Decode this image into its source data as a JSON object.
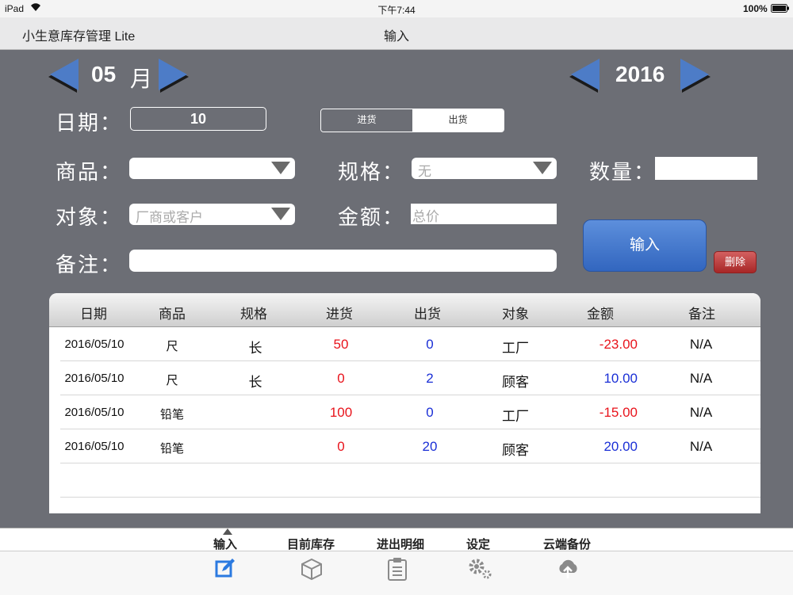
{
  "status_bar": {
    "device": "iPad",
    "time": "下午7:44",
    "battery": "100%"
  },
  "nav": {
    "app_title": "小生意库存管理 Lite",
    "screen_title": "输入"
  },
  "month_selector": {
    "value": "05",
    "unit": "月"
  },
  "year_selector": {
    "value": "2016"
  },
  "form": {
    "date_label": "日期：",
    "date_value": "10",
    "segment": {
      "options": [
        "进货",
        "出货"
      ],
      "selected": "进货"
    },
    "product_label": "商品：",
    "product_value": "",
    "spec_label": "规格：",
    "spec_placeholder": "无",
    "quantity_label": "数量：",
    "quantity_value": "",
    "target_label": "对象：",
    "target_placeholder": "厂商或客户",
    "amount_label": "金额：",
    "amount_placeholder": "总价",
    "note_label": "备注：",
    "note_value": "",
    "input_button": "输入",
    "delete_button": "删除"
  },
  "table": {
    "headers": [
      "日期",
      "商品",
      "规格",
      "进货",
      "出货",
      "对象",
      "金额",
      "备注"
    ],
    "rows": [
      {
        "date": "2016/05/10",
        "product": "尺",
        "spec": "长",
        "in": "50",
        "out": "0",
        "target": "工厂",
        "amount": "-23.00",
        "note": "N/A"
      },
      {
        "date": "2016/05/10",
        "product": "尺",
        "spec": "长",
        "in": "0",
        "out": "2",
        "target": "顾客",
        "amount": "10.00",
        "note": "N/A"
      },
      {
        "date": "2016/05/10",
        "product": "铅笔",
        "spec": "",
        "in": "100",
        "out": "0",
        "target": "工厂",
        "amount": "-15.00",
        "note": "N/A"
      },
      {
        "date": "2016/05/10",
        "product": "铅笔",
        "spec": "",
        "in": "0",
        "out": "20",
        "target": "顾客",
        "amount": "20.00",
        "note": "N/A"
      }
    ]
  },
  "tabs": [
    {
      "label": "输入",
      "icon": "edit-icon",
      "active": true
    },
    {
      "label": "目前库存",
      "icon": "box-icon",
      "active": false
    },
    {
      "label": "进出明细",
      "icon": "clipboard-icon",
      "active": false
    },
    {
      "label": "设定",
      "icon": "gear-icon",
      "active": false
    },
    {
      "label": "云端备份",
      "icon": "cloud-upload-icon",
      "active": false
    }
  ],
  "colors": {
    "accent": "#2b7ae0",
    "in_value": "#e8131b",
    "out_value": "#1a2fd6",
    "negative_amount": "#e8131b",
    "positive_amount": "#1a2fd6",
    "panel_bg": "#6c6e75"
  }
}
